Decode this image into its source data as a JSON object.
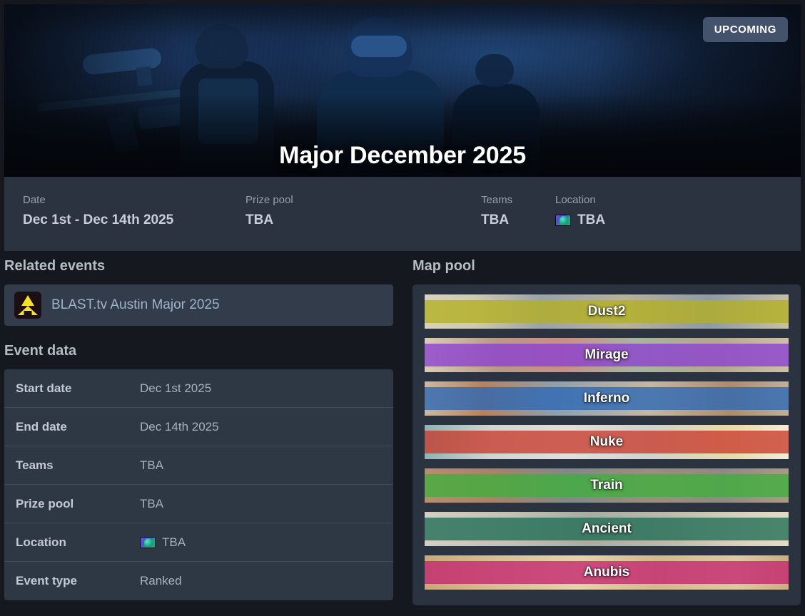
{
  "hero": {
    "title": "Major December 2025",
    "status_badge": "UPCOMING"
  },
  "infobar": [
    {
      "label": "Date",
      "value": "Dec 1st - Dec 14th 2025",
      "icon": null
    },
    {
      "label": "Prize pool",
      "value": "TBA",
      "icon": null
    },
    {
      "label": "Teams",
      "value": "TBA",
      "icon": null
    },
    {
      "label": "Location",
      "value": "TBA",
      "icon": "globe-icon"
    }
  ],
  "related": {
    "heading": "Related events",
    "items": [
      {
        "name": "BLAST.tv Austin Major 2025",
        "logo": "blast-tv-logo"
      }
    ]
  },
  "event_data": {
    "heading": "Event data",
    "rows": [
      {
        "key": "Start date",
        "value": "Dec 1st 2025",
        "icon": null
      },
      {
        "key": "End date",
        "value": "Dec 14th 2025",
        "icon": null
      },
      {
        "key": "Teams",
        "value": "TBA",
        "icon": null
      },
      {
        "key": "Prize pool",
        "value": "TBA",
        "icon": null
      },
      {
        "key": "Location",
        "value": "TBA",
        "icon": "globe-icon"
      },
      {
        "key": "Event type",
        "value": "Ranked",
        "icon": null
      }
    ]
  },
  "map_pool": {
    "heading": "Map pool",
    "maps": [
      {
        "name": "Dust2",
        "band_color": "#b4b021"
      },
      {
        "name": "Mirage",
        "band_color": "#8b3fd1"
      },
      {
        "name": "Inferno",
        "band_color": "#2a66b5"
      },
      {
        "name": "Nuke",
        "band_color": "#c83a2c"
      },
      {
        "name": "Train",
        "band_color": "#3fb03c"
      },
      {
        "name": "Ancient",
        "band_color": "#1d6b55"
      },
      {
        "name": "Anubis",
        "band_color": "#c4246f"
      }
    ]
  },
  "colors": {
    "page_bg": "#15191f",
    "panel_bg": "#2b3341",
    "table_bg": "#2e3744",
    "card_bg": "#333c4b",
    "badge_bg": "#44526b",
    "heading": "#b4bcc6",
    "label_muted": "#97a0ad",
    "link_blue": "#9fb3cb"
  }
}
